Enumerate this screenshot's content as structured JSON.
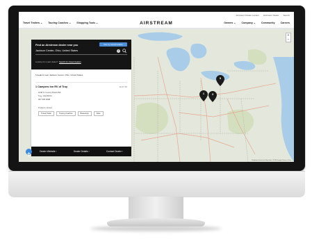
{
  "site": {
    "logo": "AIRSTREAM",
    "topbar": [
      "Airstream Dealer Locator",
      "Airstream Dealer",
      "Search"
    ],
    "nav_left": [
      {
        "label": "Travel Trailers ⌄"
      },
      {
        "label": "Touring Coaches ⌄"
      },
      {
        "label": "Shopping Tools ⌄"
      }
    ],
    "nav_right": [
      {
        "label": "Owners ⌄"
      },
      {
        "label": "Company ⌄"
      },
      {
        "label": "Community"
      },
      {
        "label": "Careers"
      }
    ]
  },
  "locator": {
    "title": "Find an Airstream dealer near you",
    "use_location_button": "Use my current location",
    "search_value": "Jackson Center, Ohio, United States",
    "sub_text": "Looking for a past dealer?",
    "sub_link": "Search for closed dealers",
    "result_count": "5 dealers near Jackson Center, Ohio, United States"
  },
  "dealer": {
    "name": "1  Campers Inn RV of Troy",
    "distance": "10.27 MI",
    "address": [
      "1040 S. County Road 25A",
      "Troy, OH 45373",
      "937.335.0098"
    ],
    "products_label": "Products carried",
    "tags": [
      "Travel Trailer",
      "Touring Coaches",
      "Basecamp",
      "Atlas"
    ]
  },
  "actions": [
    "Dealer Website ›",
    "Dealer Details ›",
    "Contact Dealer ›"
  ],
  "map": {
    "pins": [
      "1",
      "3",
      "5"
    ],
    "zoom_in": "+",
    "zoom_out": "−",
    "attribution": "Keyboard shortcuts  Map data ©2018 Google  Terms of Use"
  },
  "colors": {
    "accent": "#4c8fd6",
    "panel_dark": "#151515",
    "pin": "#1a1a1a"
  }
}
